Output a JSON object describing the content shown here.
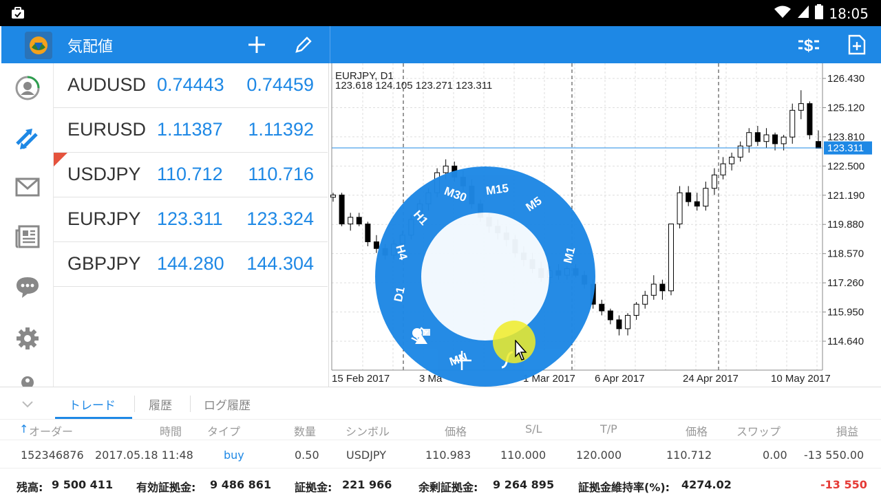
{
  "status_bar": {
    "time": "18:05",
    "icons": [
      "notification-icon",
      "wifi-icon",
      "signal-icon",
      "battery-icon"
    ]
  },
  "app_bar": {
    "title": "気配値",
    "actions": [
      "add-icon",
      "edit-icon",
      "trade-dollar-icon",
      "new-order-icon"
    ]
  },
  "sidebar": {
    "items": [
      {
        "name": "account",
        "icon": "account-icon"
      },
      {
        "name": "trade",
        "icon": "trade-arrows-icon",
        "active": true
      },
      {
        "name": "mail",
        "icon": "mail-icon"
      },
      {
        "name": "news",
        "icon": "news-icon"
      },
      {
        "name": "chat",
        "icon": "chat-icon"
      },
      {
        "name": "settings",
        "icon": "settings-icon"
      }
    ]
  },
  "quotes": [
    {
      "symbol": "AUDUSD",
      "bid": "0.74443",
      "ask": "0.74459"
    },
    {
      "symbol": "EURUSD",
      "bid": "1.11387",
      "ask": "1.11392"
    },
    {
      "symbol": "USDJPY",
      "bid": "110.712",
      "ask": "110.716",
      "flag": true
    },
    {
      "symbol": "EURJPY",
      "bid": "123.311",
      "ask": "123.324"
    },
    {
      "symbol": "GBPJPY",
      "bid": "144.280",
      "ask": "144.304"
    }
  ],
  "chart": {
    "symbol_label": "EURJPY, D1",
    "ohlc_label": "123.618 124.105 123.271 123.311",
    "current_price": "123.311",
    "y_ticks": [
      "126.430",
      "125.120",
      "123.810",
      "122.500",
      "121.190",
      "119.880",
      "118.570",
      "117.260",
      "115.950",
      "114.640"
    ],
    "x_ticks": [
      "15 Feb 2017",
      "3 Mar 2017",
      "21 Mar 2017",
      "6 Apr 2017",
      "24 Apr 2017",
      "10 May 2017"
    ],
    "x_ticks_shown": [
      "15 Feb 2017",
      "3 Ma",
      "1 Mar 2017",
      "6 Apr 2017",
      "24 Apr 2017",
      "10 May 2017"
    ]
  },
  "chart_data": {
    "type": "candlestick",
    "title": "EURJPY, D1",
    "ylim": [
      113.6,
      127.2
    ],
    "candles": [
      {
        "o": 121.1,
        "h": 121.3,
        "l": 120.9,
        "c": 121.2
      },
      {
        "o": 121.2,
        "h": 121.3,
        "l": 119.8,
        "c": 119.9
      },
      {
        "o": 119.9,
        "h": 120.4,
        "l": 119.6,
        "c": 120.2
      },
      {
        "o": 120.2,
        "h": 120.4,
        "l": 119.8,
        "c": 119.9
      },
      {
        "o": 119.9,
        "h": 120.0,
        "l": 118.9,
        "c": 119.1
      },
      {
        "o": 119.1,
        "h": 119.4,
        "l": 118.6,
        "c": 118.8
      },
      {
        "o": 118.8,
        "h": 119.0,
        "l": 118.3,
        "c": 118.5
      },
      {
        "o": 118.5,
        "h": 119.2,
        "l": 118.3,
        "c": 119.0
      },
      {
        "o": 119.0,
        "h": 119.6,
        "l": 118.8,
        "c": 119.4
      },
      {
        "o": 119.4,
        "h": 120.3,
        "l": 119.2,
        "c": 120.1
      },
      {
        "o": 120.1,
        "h": 121.0,
        "l": 119.9,
        "c": 120.8
      },
      {
        "o": 120.8,
        "h": 121.5,
        "l": 120.5,
        "c": 121.3
      },
      {
        "o": 121.3,
        "h": 122.4,
        "l": 121.1,
        "c": 122.2
      },
      {
        "o": 122.2,
        "h": 122.8,
        "l": 121.9,
        "c": 122.5
      },
      {
        "o": 122.5,
        "h": 122.7,
        "l": 121.8,
        "c": 122.0
      },
      {
        "o": 122.0,
        "h": 122.3,
        "l": 121.4,
        "c": 121.6
      },
      {
        "o": 121.6,
        "h": 121.9,
        "l": 120.6,
        "c": 120.8
      },
      {
        "o": 120.8,
        "h": 121.0,
        "l": 120.0,
        "c": 120.2
      },
      {
        "o": 120.2,
        "h": 120.4,
        "l": 119.5,
        "c": 119.8
      },
      {
        "o": 119.8,
        "h": 120.1,
        "l": 119.2,
        "c": 119.5
      },
      {
        "o": 119.5,
        "h": 119.8,
        "l": 118.9,
        "c": 119.2
      },
      {
        "o": 119.2,
        "h": 119.4,
        "l": 118.4,
        "c": 118.6
      },
      {
        "o": 118.6,
        "h": 118.9,
        "l": 118.0,
        "c": 118.3
      },
      {
        "o": 118.3,
        "h": 118.6,
        "l": 117.7,
        "c": 117.9
      },
      {
        "o": 117.9,
        "h": 118.2,
        "l": 117.3,
        "c": 117.5
      },
      {
        "o": 117.5,
        "h": 118.0,
        "l": 117.2,
        "c": 117.8
      },
      {
        "o": 117.8,
        "h": 118.1,
        "l": 117.4,
        "c": 117.6
      },
      {
        "o": 117.6,
        "h": 118.0,
        "l": 117.4,
        "c": 117.9
      },
      {
        "o": 117.9,
        "h": 118.1,
        "l": 117.5,
        "c": 117.6
      },
      {
        "o": 117.6,
        "h": 117.8,
        "l": 117.0,
        "c": 117.2
      },
      {
        "o": 117.2,
        "h": 117.4,
        "l": 116.1,
        "c": 116.3
      },
      {
        "o": 116.3,
        "h": 116.5,
        "l": 115.8,
        "c": 116.0
      },
      {
        "o": 116.0,
        "h": 116.1,
        "l": 115.4,
        "c": 115.6
      },
      {
        "o": 115.6,
        "h": 115.8,
        "l": 114.9,
        "c": 115.2
      },
      {
        "o": 115.2,
        "h": 115.9,
        "l": 114.9,
        "c": 115.8
      },
      {
        "o": 115.8,
        "h": 116.4,
        "l": 115.6,
        "c": 116.3
      },
      {
        "o": 116.3,
        "h": 116.9,
        "l": 116.1,
        "c": 116.7
      },
      {
        "o": 116.7,
        "h": 117.6,
        "l": 116.5,
        "c": 117.2
      },
      {
        "o": 117.2,
        "h": 117.4,
        "l": 116.5,
        "c": 116.9
      },
      {
        "o": 116.9,
        "h": 119.7,
        "l": 116.7,
        "c": 119.9
      },
      {
        "o": 119.9,
        "h": 121.6,
        "l": 119.7,
        "c": 121.3
      },
      {
        "o": 121.3,
        "h": 121.6,
        "l": 120.7,
        "c": 120.9
      },
      {
        "o": 120.9,
        "h": 121.3,
        "l": 120.5,
        "c": 120.7
      },
      {
        "o": 120.7,
        "h": 121.8,
        "l": 120.5,
        "c": 121.5
      },
      {
        "o": 121.5,
        "h": 122.4,
        "l": 121.2,
        "c": 122.1
      },
      {
        "o": 122.1,
        "h": 122.9,
        "l": 121.9,
        "c": 122.6
      },
      {
        "o": 122.6,
        "h": 123.1,
        "l": 122.3,
        "c": 122.9
      },
      {
        "o": 122.9,
        "h": 123.6,
        "l": 122.7,
        "c": 123.4
      },
      {
        "o": 123.4,
        "h": 124.2,
        "l": 123.1,
        "c": 124.0
      },
      {
        "o": 124.0,
        "h": 124.3,
        "l": 123.4,
        "c": 123.6
      },
      {
        "o": 123.6,
        "h": 124.2,
        "l": 123.3,
        "c": 123.9
      },
      {
        "o": 123.9,
        "h": 124.0,
        "l": 123.2,
        "c": 123.5
      },
      {
        "o": 123.5,
        "h": 123.9,
        "l": 123.2,
        "c": 123.8
      },
      {
        "o": 123.8,
        "h": 125.3,
        "l": 123.5,
        "c": 125.0
      },
      {
        "o": 125.0,
        "h": 125.9,
        "l": 124.6,
        "c": 125.3
      },
      {
        "o": 125.3,
        "h": 125.4,
        "l": 123.7,
        "c": 123.9
      },
      {
        "o": 123.6,
        "h": 124.1,
        "l": 123.3,
        "c": 123.3
      }
    ]
  },
  "timeframe_wheel": {
    "labels": [
      "M1",
      "M5",
      "M15",
      "M30",
      "H1",
      "H4",
      "D1",
      "W1",
      "MN"
    ],
    "tools": [
      "objects-icon",
      "crosshair-icon",
      "indicator-icon"
    ]
  },
  "bottom_panel": {
    "tabs": [
      "トレード",
      "履歴",
      "ログ履歴"
    ],
    "headers": [
      "オーダー",
      "時間",
      "タイプ",
      "数量",
      "シンボル",
      "価格",
      "S/L",
      "T/P",
      "価格",
      "スワップ",
      "損益"
    ],
    "row": {
      "order": "152346876",
      "time": "2017.05.18 11:48",
      "type": "buy",
      "volume": "0.50",
      "symbol": "USDJPY",
      "open_price": "110.983",
      "sl": "110.000",
      "tp": "120.000",
      "price": "110.712",
      "swap": "0.00",
      "profit": "-13 550.00"
    },
    "summary": {
      "balance_label": "残高:",
      "balance": "9 500 411",
      "equity_label": "有効証拠金:",
      "equity": "9 486 861",
      "margin_label": "証拠金:",
      "margin": "221 966",
      "free_margin_label": "余剰証拠金:",
      "free_margin": "9 264 895",
      "margin_level_label": "証拠金維持率(%):",
      "margin_level": "4274.02",
      "total_profit": "-13 550"
    }
  },
  "colors": {
    "accent": "#1e88e5",
    "loss": "#e53935",
    "flag": "#e5533d",
    "cursor_highlight": "#f0ec28"
  }
}
